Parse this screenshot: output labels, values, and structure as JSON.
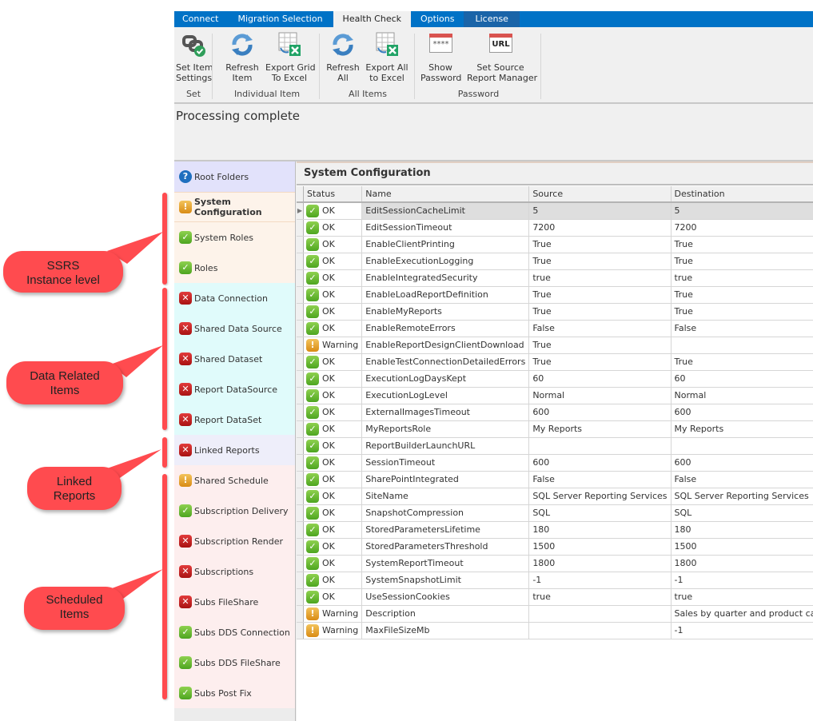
{
  "tabs": [
    {
      "label": "Connect",
      "active": false
    },
    {
      "label": "Migration Selection",
      "active": false
    },
    {
      "label": "Health Check",
      "active": true
    },
    {
      "label": "Options",
      "active": false
    },
    {
      "label": "License",
      "active": false
    }
  ],
  "ribbon": {
    "groups": [
      {
        "label": "Set",
        "buttons": [
          {
            "line1": "Set Item",
            "line2": "Settings",
            "icon": "link-check-icon"
          }
        ]
      },
      {
        "label": "Individual Item",
        "buttons": [
          {
            "line1": "Refresh",
            "line2": "Item",
            "icon": "refresh-icon"
          },
          {
            "line1": "Export Grid",
            "line2": "To Excel",
            "icon": "excel-export-icon"
          }
        ]
      },
      {
        "label": "All Items",
        "buttons": [
          {
            "line1": "Refresh",
            "line2": "All",
            "icon": "refresh-icon"
          },
          {
            "line1": "Export All",
            "line2": "to Excel",
            "icon": "excel-export-icon"
          }
        ]
      },
      {
        "label": "Password",
        "buttons": [
          {
            "line1": "Show",
            "line2": "Password",
            "icon": "password-icon",
            "icon_text": "****"
          },
          {
            "line1": "Set Source",
            "line2": "Report Manager",
            "icon": "url-icon",
            "icon_text": "URL"
          }
        ]
      }
    ]
  },
  "status_message": "Processing complete",
  "nav": {
    "items": [
      {
        "label": "Root Folders",
        "status": "help",
        "group": "blue"
      },
      {
        "label": "System Configuration",
        "status": "warn",
        "group": "peach",
        "selected": true
      },
      {
        "label": "System Roles",
        "status": "ok",
        "group": "peach"
      },
      {
        "label": "Roles",
        "status": "ok",
        "group": "peach"
      },
      {
        "label": "Data Connection",
        "status": "err",
        "group": "cyan"
      },
      {
        "label": "Shared Data Source",
        "status": "err",
        "group": "cyan"
      },
      {
        "label": "Shared Dataset",
        "status": "err",
        "group": "cyan"
      },
      {
        "label": "Report DataSource",
        "status": "err",
        "group": "cyan"
      },
      {
        "label": "Report DataSet",
        "status": "err",
        "group": "cyan"
      },
      {
        "label": "Linked Reports",
        "status": "err",
        "group": "lav"
      },
      {
        "label": "Shared Schedule",
        "status": "warn",
        "group": "pink"
      },
      {
        "label": "Subscription Delivery",
        "status": "ok",
        "group": "pink"
      },
      {
        "label": "Subscription Render",
        "status": "err",
        "group": "pink"
      },
      {
        "label": "Subscriptions",
        "status": "err",
        "group": "pink"
      },
      {
        "label": "Subs FileShare",
        "status": "err",
        "group": "pink"
      },
      {
        "label": "Subs DDS Connection",
        "status": "ok",
        "group": "pink"
      },
      {
        "label": "Subs DDS FileShare",
        "status": "ok",
        "group": "pink"
      },
      {
        "label": "Subs Post Fix",
        "status": "ok",
        "group": "pink"
      }
    ]
  },
  "panel": {
    "title": "System Configuration",
    "columns": [
      "Status",
      "Name",
      "Source",
      "Destination"
    ],
    "rows": [
      {
        "status": "OK",
        "name": "EditSessionCacheLimit",
        "source": "5",
        "destination": "5",
        "selected": true
      },
      {
        "status": "OK",
        "name": "EditSessionTimeout",
        "source": "7200",
        "destination": "7200"
      },
      {
        "status": "OK",
        "name": "EnableClientPrinting",
        "source": "True",
        "destination": "True"
      },
      {
        "status": "OK",
        "name": "EnableExecutionLogging",
        "source": "True",
        "destination": "True"
      },
      {
        "status": "OK",
        "name": "EnableIntegratedSecurity",
        "source": "true",
        "destination": "true"
      },
      {
        "status": "OK",
        "name": "EnableLoadReportDefinition",
        "source": "True",
        "destination": "True"
      },
      {
        "status": "OK",
        "name": "EnableMyReports",
        "source": "True",
        "destination": "True"
      },
      {
        "status": "OK",
        "name": "EnableRemoteErrors",
        "source": "False",
        "destination": "False"
      },
      {
        "status": "Warning",
        "name": "EnableReportDesignClientDownload",
        "source": "True",
        "destination": ""
      },
      {
        "status": "OK",
        "name": "EnableTestConnectionDetailedErrors",
        "source": "True",
        "destination": "True"
      },
      {
        "status": "OK",
        "name": "ExecutionLogDaysKept",
        "source": "60",
        "destination": "60"
      },
      {
        "status": "OK",
        "name": "ExecutionLogLevel",
        "source": "Normal",
        "destination": "Normal"
      },
      {
        "status": "OK",
        "name": "ExternalImagesTimeout",
        "source": "600",
        "destination": "600"
      },
      {
        "status": "OK",
        "name": "MyReportsRole",
        "source": "My Reports",
        "destination": "My Reports"
      },
      {
        "status": "OK",
        "name": "ReportBuilderLaunchURL",
        "source": "",
        "destination": ""
      },
      {
        "status": "OK",
        "name": "SessionTimeout",
        "source": "600",
        "destination": "600"
      },
      {
        "status": "OK",
        "name": "SharePointIntegrated",
        "source": "False",
        "destination": "False"
      },
      {
        "status": "OK",
        "name": "SiteName",
        "source": "SQL Server Reporting Services",
        "destination": "SQL Server Reporting Services"
      },
      {
        "status": "OK",
        "name": "SnapshotCompression",
        "source": "SQL",
        "destination": "SQL"
      },
      {
        "status": "OK",
        "name": "StoredParametersLifetime",
        "source": "180",
        "destination": "180"
      },
      {
        "status": "OK",
        "name": "StoredParametersThreshold",
        "source": "1500",
        "destination": "1500"
      },
      {
        "status": "OK",
        "name": "SystemReportTimeout",
        "source": "1800",
        "destination": "1800"
      },
      {
        "status": "OK",
        "name": "SystemSnapshotLimit",
        "source": "-1",
        "destination": "-1"
      },
      {
        "status": "OK",
        "name": "UseSessionCookies",
        "source": "true",
        "destination": "true"
      },
      {
        "status": "Warning",
        "name": "Description",
        "source": "",
        "destination": "Sales by quarter and product category."
      },
      {
        "status": "Warning",
        "name": "MaxFileSizeMb",
        "source": "",
        "destination": "-1"
      }
    ]
  },
  "annotations": [
    {
      "line1": "SSRS",
      "line2": "Instance level"
    },
    {
      "line1": "Data Related",
      "line2": "Items"
    },
    {
      "line1": "Linked",
      "line2": "Reports"
    },
    {
      "line1": "Scheduled",
      "line2": "Items"
    }
  ],
  "colors": {
    "accent": "#0072c6",
    "callout": "#ff4b4f",
    "ok": "#5cb52a",
    "warning": "#e8a22e",
    "error": "#c21d1d"
  }
}
